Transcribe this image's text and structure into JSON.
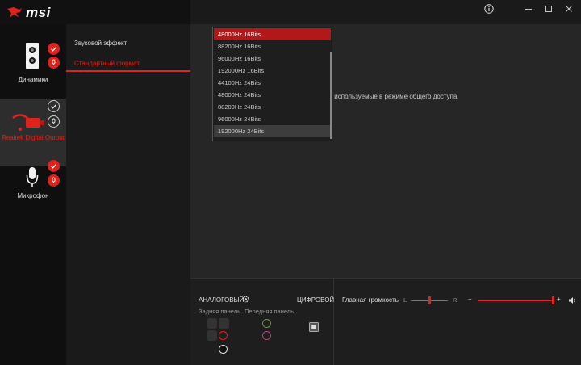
{
  "app": {
    "logo_text": "msi"
  },
  "sidebar": {
    "devices": [
      {
        "label": "Динамики"
      },
      {
        "label": "Realtek Digital Output"
      },
      {
        "label": "Микрофон"
      }
    ]
  },
  "menu": {
    "items": [
      {
        "label": "Звуковой эффект"
      },
      {
        "label": "Стандартный формат"
      }
    ]
  },
  "main": {
    "description_partial": "сть, используемые в режиме общего доступа."
  },
  "format_dropdown": {
    "options": [
      "48000Hz 16Bits",
      "88200Hz 16Bits",
      "96000Hz 16Bits",
      "192000Hz 16Bits",
      "44100Hz 24Bits",
      "48000Hz 24Bits",
      "88200Hz 24Bits",
      "96000Hz 24Bits",
      "192000Hz 24Bits"
    ]
  },
  "connectors": {
    "analog_label": "АНАЛОГОВЫЙ",
    "digital_label": "ЦИФРОВОЙ",
    "rear_panel_label": "Задняя панель",
    "front_panel_label": "Передняя панель"
  },
  "volume": {
    "label": "Главная громкость",
    "balance_left": "L",
    "balance_right": "R",
    "minus": "−",
    "plus": "+",
    "balance_position": 0.5,
    "level": 1.0
  },
  "colors": {
    "accent": "#e0221c",
    "green_port": "#6a9a2a",
    "pink_port": "#b04a7a"
  }
}
